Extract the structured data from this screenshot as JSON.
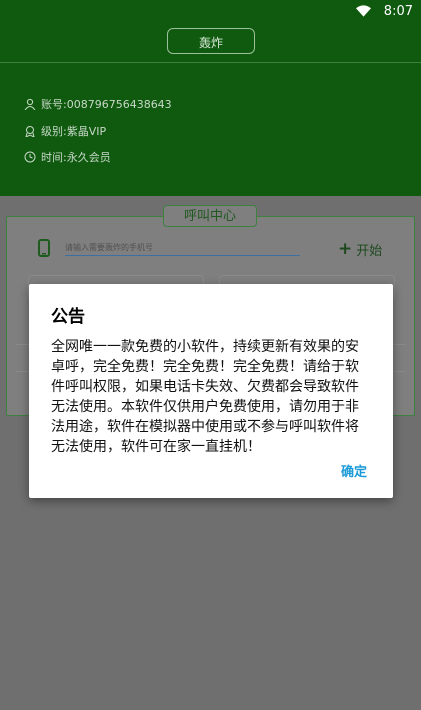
{
  "status_bar": {
    "time": "8:07"
  },
  "header": {
    "top_button_label": "轰炸"
  },
  "profile": {
    "account": "账号:008796756438643",
    "level": "级别:紫晶VIP",
    "time": "时间:永久会员"
  },
  "call_center": {
    "title": "呼叫中心",
    "phone_placeholder": "请输入需要轰炸的手机号",
    "start_label": "开始"
  },
  "dialog": {
    "title": "公告",
    "body": "全网唯一一款免费的小软件，持续更新有效果的安卓呼，完全免费！完全免费！完全免费！请给于软件呼叫权限，如果电话卡失效、欠费都会导致软件无法使用。本软件仅供用户免费使用，请勿用于非法用途，软件在模拟器中使用或不参与呼叫软件将无法使用，软件可在家一直挂机！",
    "ok_label": "确定"
  },
  "colors": {
    "header_green": "#0f5a0f",
    "accent_blue": "#1a9ad6"
  }
}
